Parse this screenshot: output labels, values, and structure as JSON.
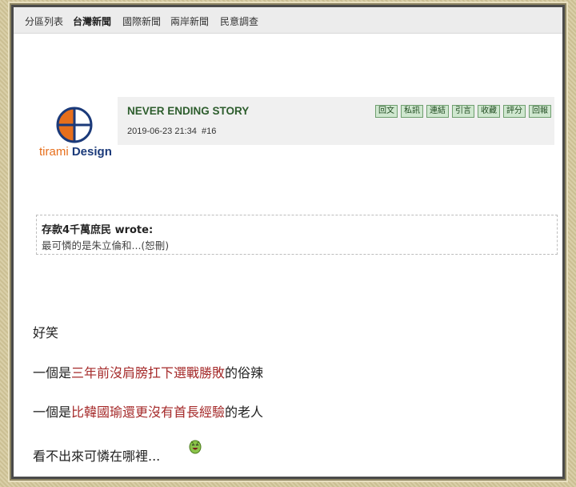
{
  "nav": {
    "items": [
      "分區列表",
      "台灣新聞",
      "國際新聞",
      "兩岸新聞",
      "民意調查"
    ]
  },
  "logo": {
    "text_part1": "tirami",
    "text_part2": "Design"
  },
  "post": {
    "title": "NEVER ENDING STORY",
    "timestamp": "2019-06-23 21:34",
    "number": "#16",
    "actions": [
      "回文",
      "私訊",
      "連結",
      "引言",
      "收藏",
      "評分",
      "回報"
    ]
  },
  "quote": {
    "author": "存款4千萬庶民 wrote:",
    "text": "最可憐的是朱立倫和...(恕刪)"
  },
  "body": {
    "line1": "好笑",
    "line2_pre": "一個是",
    "line2_red": "三年前沒肩膀扛下選戰勝敗",
    "line2_post": "的俗辣",
    "line3_pre": "一個是",
    "line3_red": "比韓國瑜還更沒有首長經驗",
    "line3_post": "的老人",
    "line4": "看不出來可憐在哪裡..."
  },
  "colors": {
    "accent_red": "#a52a2a",
    "title_green": "#2d5d2d",
    "logo_orange": "#e76f1c",
    "logo_blue": "#1b3a7a"
  },
  "icons": {
    "emoji": "laughing-emoji-icon"
  }
}
